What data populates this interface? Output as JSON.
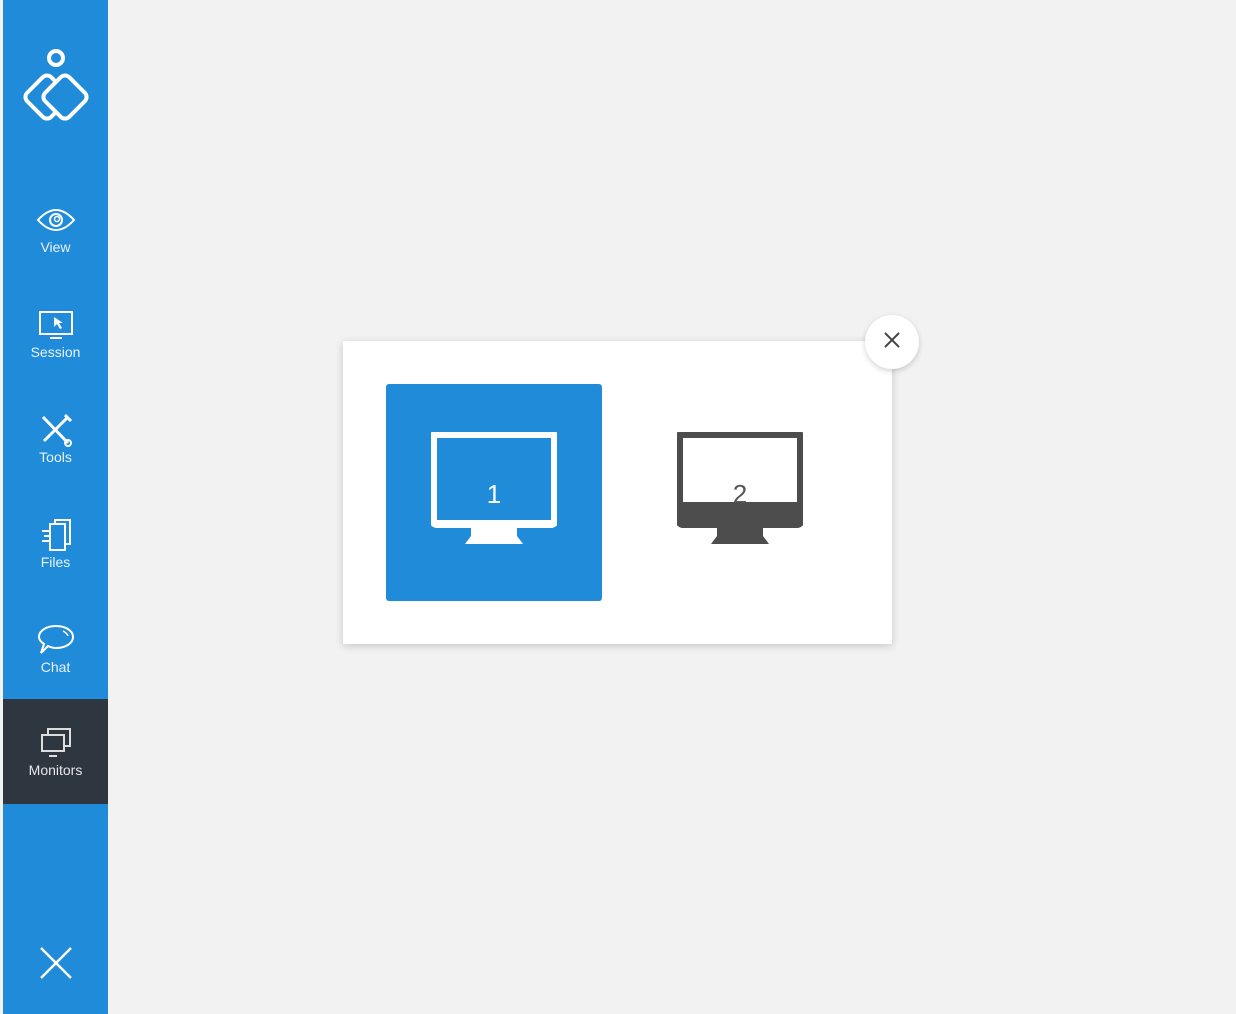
{
  "sidebar": {
    "logo": "app-logo",
    "items": [
      {
        "label": "View",
        "icon": "eye-icon",
        "active": false
      },
      {
        "label": "Session",
        "icon": "monitor-cursor-icon",
        "active": false
      },
      {
        "label": "Tools",
        "icon": "tools-icon",
        "active": false
      },
      {
        "label": "Files",
        "icon": "files-icon",
        "active": false
      },
      {
        "label": "Chat",
        "icon": "chat-bubble-icon",
        "active": false
      },
      {
        "label": "Monitors",
        "icon": "monitors-icon",
        "active": true
      }
    ],
    "exit_icon": "close-icon"
  },
  "monitor_dialog": {
    "monitors": [
      {
        "number": "1",
        "selected": true
      },
      {
        "number": "2",
        "selected": false
      }
    ],
    "close_icon": "close-icon"
  },
  "colors": {
    "accent": "#208bd8",
    "active_item": "#2e3640",
    "monitor_dark": "#4d4d4d",
    "background": "#f2f2f2"
  }
}
